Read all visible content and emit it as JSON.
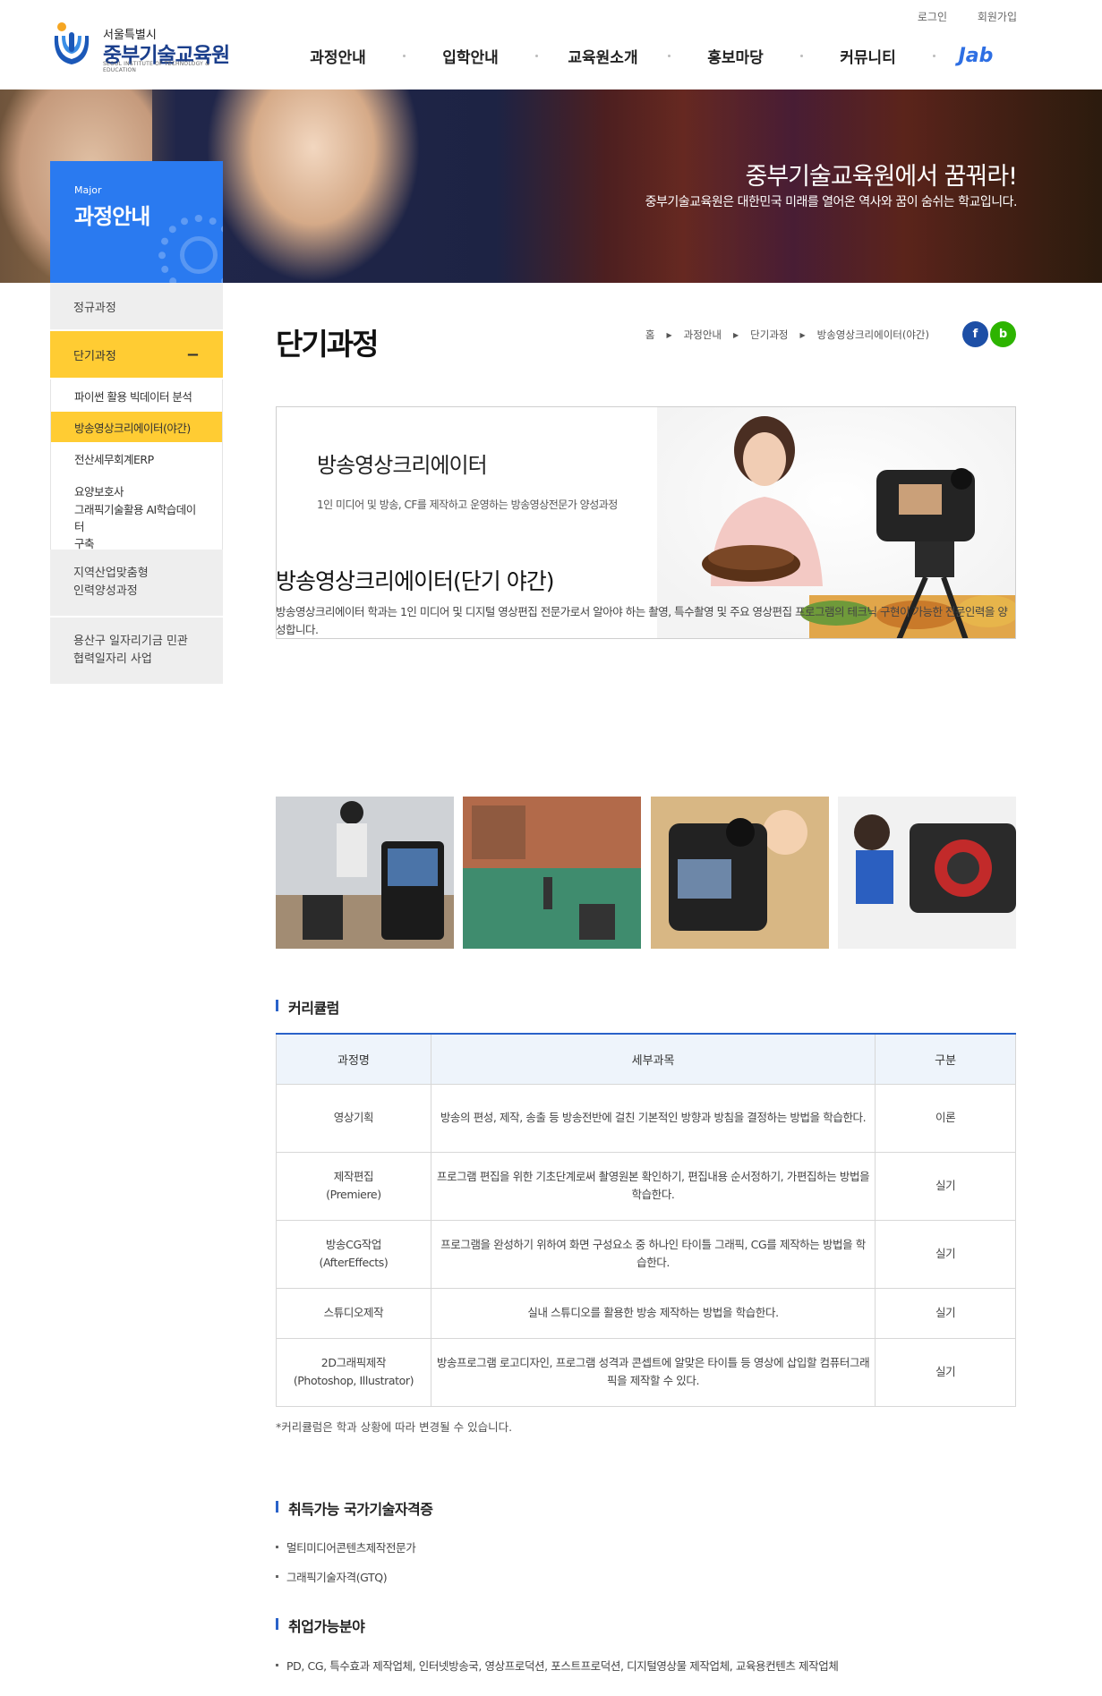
{
  "header": {
    "logo_sub": "서울특별시",
    "logo_main": "중부기술교육원",
    "logo_eng": "SEOUL INSTITUTE OF TECHNOLOGY & EDUCATION",
    "login": "로그인",
    "join": "회원가입",
    "nav": [
      "과정안내",
      "입학안내",
      "교육원소개",
      "홍보마당",
      "커뮤니티"
    ],
    "job_label": "Jab"
  },
  "banner": {
    "title": "중부기술교육원에서 꿈꿔라!",
    "subtitle": "중부기술교육원은 대한민국 미래를 열어온 역사와 꿈이 숨쉬는 학교입니다."
  },
  "sidebar": {
    "major_label": "Major",
    "major_title": "과정안내",
    "groups": [
      "정규과정",
      "단기과정",
      "지역산업맞춤형\n인력양성과정",
      "용산구 일자리기금 민관\n협력일자리 사업"
    ],
    "active_group_symbol": "−",
    "sub_items": [
      "파이썬 활용 빅데이터 분석",
      "방송영상크리에이터(야간)",
      "전산세무회계ERP",
      "요양보호사",
      "그래픽기술활용 AI학습데이터\n구축"
    ]
  },
  "page": {
    "title": "단기과정",
    "breadcrumb": [
      "홈",
      "과정안내",
      "단기과정",
      "방송영상크리에이터(야간)"
    ],
    "sns": [
      "f",
      "b"
    ],
    "hero_title": "방송영상크리에이터",
    "hero_desc": "1인 미디어 및 방송, CF를 제작하고 운영하는 방송영상전문가 양성과정",
    "section_title": "방송영상크리에이터(단기 야간)",
    "section_desc": "방송영상크리에이터 학과는 1인 미디어 및 디지털 영상편집 전문가로서 알아야 하는 촬영, 특수촬영 및 주요 영상편집 프로그램의 테크닉 구현이 가능한 전문인력을 양성합니다.",
    "curriculum_title": "커리큘럼",
    "table_headers": [
      "과정명",
      "세부과목",
      "구분"
    ],
    "table_rows": [
      [
        "영상기획",
        "방송의 편성, 제작, 송출 등 방송전반에 걸친 기본적인 방향과 방침을 결정하는 방법을 학습한다.",
        "이론"
      ],
      [
        "제작편집\n(Premiere)",
        "프로그램 편집을 위한 기초단계로써 촬영원본 확인하기, 편집내용 순서정하기, 가편집하는 방법을 학습한다.",
        "실기"
      ],
      [
        "방송CG작업\n(AfterEffects)",
        "프로그램을 완성하기 위하여 화면 구성요소 중 하나인 타이틀 그래픽, CG를 제작하는 방법을 학습한다.",
        "실기"
      ],
      [
        "스튜디오제작",
        "실내 스튜디오를 활용한 방송 제작하는 방법을 학습한다.",
        "실기"
      ],
      [
        "2D그래픽제작\n(Photoshop, Illustrator)",
        "방송프로그램 로고디자인, 프로그램 성격과 콘셉트에 알맞은 타이틀 등 영상에 삽입할 컴퓨터그래픽을 제작할 수 있다.",
        "실기"
      ]
    ],
    "table_note": "*커리큘럼은 학과 상황에 따라 변경될 수 있습니다.",
    "cert_title": "취득가능 국가기술자격증",
    "certs": [
      "멀티미디어콘텐츠제작전문가",
      "그래픽기술자격(GTQ)"
    ],
    "jobs_title": "취업가능분야",
    "jobs": [
      "PD, CG, 특수효과 제작업체, 인터넷방송국, 영상프로덕션, 포스트프로덕션, 디지털영상물 제작업체, 교육용컨텐츠 제작업체"
    ]
  },
  "colors": {
    "primary_blue": "#2a7af0",
    "active_yellow": "#ffcc33",
    "table_accent": "#2a62c9",
    "facebook": "#1d4fa6",
    "blog": "#2db400"
  }
}
